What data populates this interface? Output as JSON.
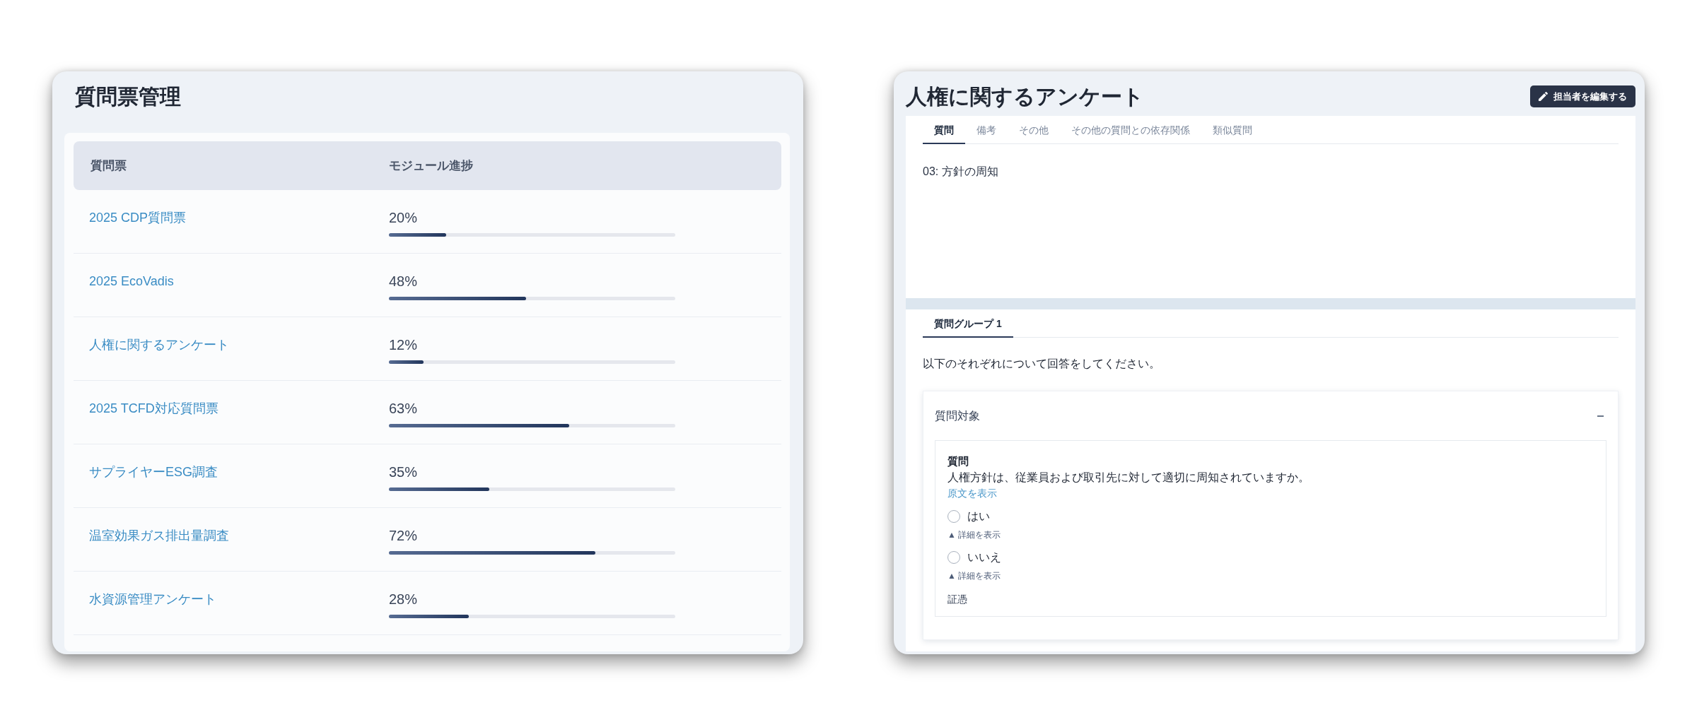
{
  "questionnaire_list": {
    "title": "質問票管理",
    "table": {
      "columns": [
        "質問票",
        "モジュール進捗"
      ],
      "rows": [
        {
          "name": "2025 CDP質問票",
          "progress": "20%",
          "level": 0.2
        },
        {
          "name": "2025 EcoVadis",
          "progress": "48%",
          "level": 0.48
        },
        {
          "name": "人権に関するアンケート",
          "progress": "12%",
          "level": 0.12
        },
        {
          "name": "2025 TCFD対応質問票",
          "progress": "63%",
          "level": 0.63
        },
        {
          "name": "サプライヤーESG調査",
          "progress": "35%",
          "level": 0.35
        },
        {
          "name": "温室効果ガス排出量調査",
          "progress": "72%",
          "level": 0.72
        },
        {
          "name": "水資源管理アンケート",
          "progress": "28%",
          "level": 0.28
        }
      ]
    }
  },
  "questionnaire_detail": {
    "title": "人権に関するアンケート",
    "edit_button": "担当者を編集する",
    "tabs": [
      {
        "label": "質問",
        "selected": true
      },
      {
        "label": "備考",
        "selected": false
      },
      {
        "label": "その他",
        "selected": false
      },
      {
        "label": "その他の質問との依存関係",
        "selected": false
      },
      {
        "label": "類似質問",
        "selected": false
      }
    ],
    "question_title": "03: 方針の周知",
    "group_tabs": [
      {
        "label": "質問グループ 1",
        "selected": true
      }
    ],
    "instruction": "以下のそれぞれについて回答をしてください。",
    "section": {
      "title": "質問対象",
      "expanded": true,
      "question_label": "質問",
      "question_text": "人権方針は、従業員および取引先に対して適切に周知されていますか。",
      "original_link": "原文を表示",
      "options": [
        {
          "label": "はい",
          "selected": false,
          "details_link": "▲ 詳細を表示"
        },
        {
          "label": "いいえ",
          "selected": false,
          "details_link": "▲ 詳細を表示"
        }
      ],
      "evidence_label": "証憑"
    }
  }
}
